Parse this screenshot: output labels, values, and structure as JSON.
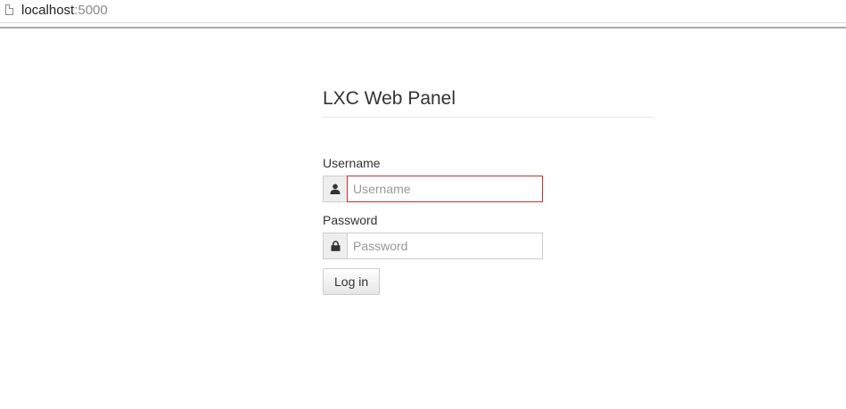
{
  "browser": {
    "url_host": "localhost",
    "url_port": ":5000"
  },
  "page": {
    "title": "LXC Web Panel"
  },
  "form": {
    "username": {
      "label": "Username",
      "placeholder": "Username",
      "value": "",
      "icon": "user-icon"
    },
    "password": {
      "label": "Password",
      "placeholder": "Password",
      "value": "",
      "icon": "lock-icon"
    },
    "submit_label": "Log in"
  },
  "colors": {
    "focus_border": "#c9302c",
    "addon_background": "#eeeeee"
  }
}
